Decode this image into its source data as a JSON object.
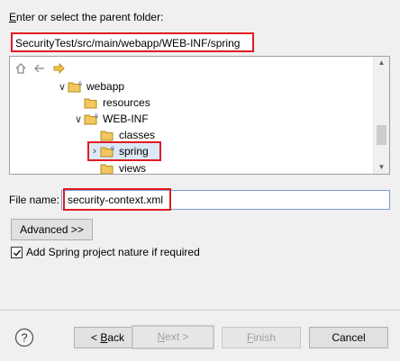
{
  "parent_folder": {
    "label": "Enter or select the parent folder:",
    "value": "SecurityTest/src/main/webapp/WEB-INF/spring"
  },
  "tree": {
    "toolbar_icons": [
      "home-icon",
      "back-arrow-icon",
      "forward-arrow-icon"
    ],
    "items": [
      {
        "label": "webapp",
        "expanded": true
      },
      {
        "label": "resources"
      },
      {
        "label": "WEB-INF",
        "expanded": true
      },
      {
        "label": "classes"
      },
      {
        "label": "spring",
        "selected": true
      },
      {
        "label": "views"
      }
    ]
  },
  "file_name": {
    "label": "File name:",
    "value": "security-context.xml"
  },
  "advanced_button": "Advanced >>",
  "checkbox": {
    "label": "Add Spring project nature if required",
    "checked": true
  },
  "buttons": {
    "back": "< Back",
    "next": "Next >",
    "finish": "Finish",
    "cancel": "Cancel"
  },
  "colors": {
    "highlight": "#e01b24",
    "folder": "#e8b84a"
  }
}
